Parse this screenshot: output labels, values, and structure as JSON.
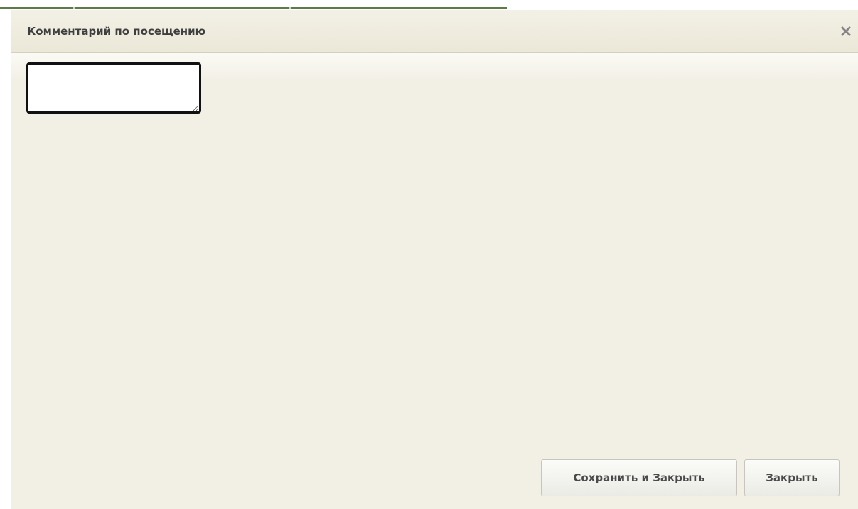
{
  "dialog": {
    "title": "Комментарий по посещению",
    "close_icon": "close-x-icon"
  },
  "comment": {
    "value": "",
    "placeholder": ""
  },
  "footer": {
    "save_close_label": "Сохранить и Закрыть",
    "close_label": "Закрыть"
  },
  "colors": {
    "dialog_background": "#f2f0e5",
    "header_title": "#3f3f3f",
    "top_strip_accent": "#5e7a48",
    "field_border": "#111111"
  }
}
